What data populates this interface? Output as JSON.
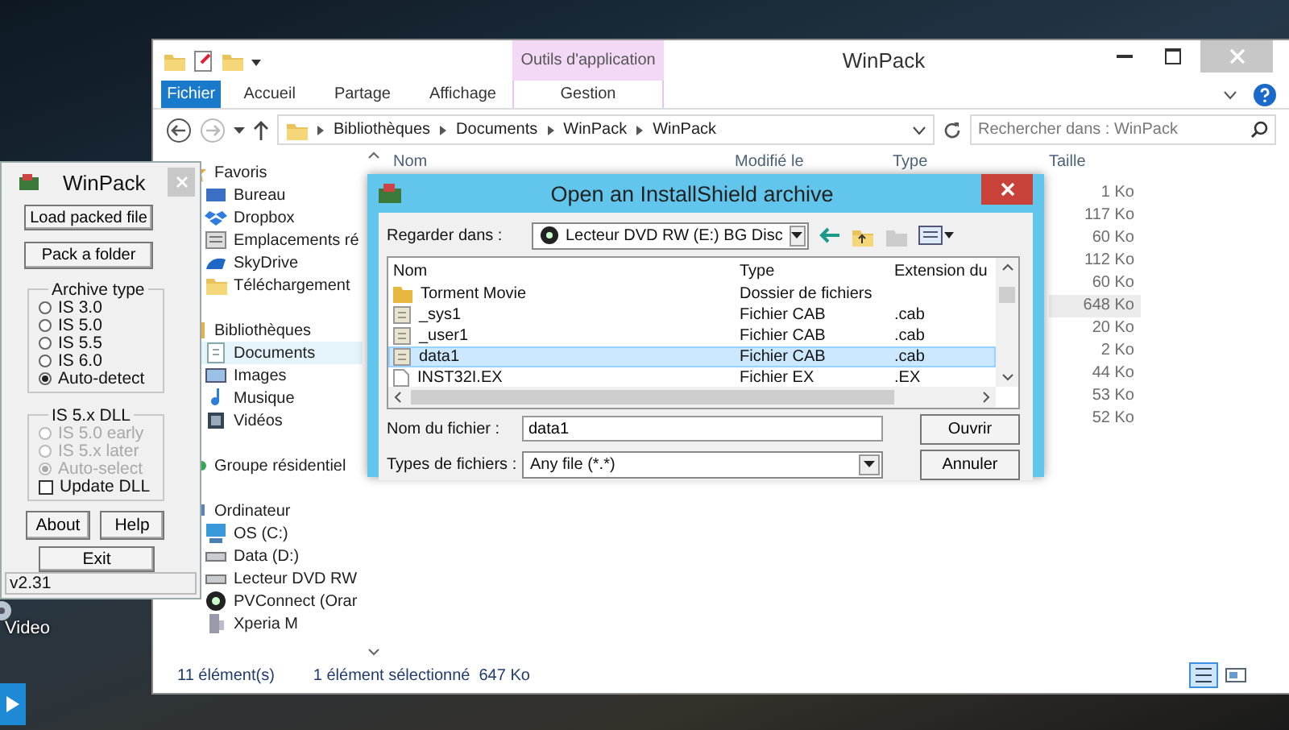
{
  "desktop": {
    "icon_label": "Video"
  },
  "explorer": {
    "title": "WinPack",
    "context_group": "Outils d'application",
    "ribbon_tabs": [
      {
        "label": "Fichier",
        "kind": "file",
        "selected": false
      },
      {
        "label": "Accueil",
        "kind": "tab",
        "selected": false
      },
      {
        "label": "Partage",
        "kind": "tab",
        "selected": false
      },
      {
        "label": "Affichage",
        "kind": "tab",
        "selected": false
      },
      {
        "label": "Gestion",
        "kind": "context",
        "selected": false
      }
    ],
    "breadcrumb": [
      "Bibliothèques",
      "Documents",
      "WinPack",
      "WinPack"
    ],
    "search": {
      "placeholder": "Rechercher dans : WinPack"
    },
    "nav": [
      {
        "label": "Favoris",
        "selected": false,
        "children": [
          {
            "label": "Bureau",
            "selected": false
          },
          {
            "label": "Dropbox",
            "selected": false
          },
          {
            "label": "Emplacements ré",
            "selected": false
          },
          {
            "label": "SkyDrive",
            "selected": false
          },
          {
            "label": "Téléchargement",
            "selected": false
          }
        ]
      },
      {
        "label": "Bibliothèques",
        "selected": false,
        "children": [
          {
            "label": "Documents",
            "selected": true
          },
          {
            "label": "Images",
            "selected": false
          },
          {
            "label": "Musique",
            "selected": false
          },
          {
            "label": "Vidéos",
            "selected": false
          }
        ]
      },
      {
        "label": "Groupe résidentiel",
        "selected": false
      },
      {
        "label": "Ordinateur",
        "selected": false,
        "children": [
          {
            "label": "OS (C:)",
            "selected": false
          },
          {
            "label": "Data (D:)",
            "selected": false
          },
          {
            "label": "Lecteur DVD RW",
            "selected": false
          },
          {
            "label": "PVConnect (Orar",
            "selected": false
          },
          {
            "label": "Xperia M",
            "selected": false
          }
        ]
      }
    ],
    "columns": [
      "Nom",
      "Modifié le",
      "Type",
      "Taille"
    ],
    "rows": [
      {
        "size": "1 Ko",
        "selected": false
      },
      {
        "size": "117 Ko",
        "selected": false
      },
      {
        "size": "60 Ko",
        "selected": false
      },
      {
        "size": "112 Ko",
        "selected": false
      },
      {
        "size": "60 Ko",
        "selected": false
      },
      {
        "size": "648 Ko",
        "selected": true
      },
      {
        "size": "20 Ko",
        "selected": false
      },
      {
        "size": "2 Ko",
        "selected": false
      },
      {
        "size": "44 Ko",
        "selected": false
      },
      {
        "size": "53 Ko",
        "selected": false
      },
      {
        "size": "52 Ko",
        "selected": false
      }
    ],
    "status": {
      "count": "11 élément(s)",
      "selection": "1 élément sélectionné  647 Ko"
    }
  },
  "winpack": {
    "title": "WinPack",
    "buttons": [
      "Load packed file",
      "Pack a folder"
    ],
    "archive_type": {
      "label": "Archive type",
      "options": [
        {
          "label": "IS 3.0",
          "selected": false
        },
        {
          "label": "IS 5.0",
          "selected": false
        },
        {
          "label": "IS 5.5",
          "selected": false
        },
        {
          "label": "IS 6.0",
          "selected": false
        },
        {
          "label": "Auto-detect",
          "selected": true
        }
      ]
    },
    "dll": {
      "label": "IS 5.x DLL",
      "options": [
        {
          "label": "IS 5.0 early",
          "selected": false,
          "disabled": true
        },
        {
          "label": "IS 5.x later",
          "selected": false,
          "disabled": true
        },
        {
          "label": "Auto-select",
          "selected": true,
          "disabled": true
        }
      ],
      "update": {
        "label": "Update DLL",
        "checked": false
      }
    },
    "about": "About",
    "help": "Help",
    "exit": "Exit",
    "version": "v2.31"
  },
  "dialog": {
    "title": "Open an InstallShield archive",
    "look_in_label": "Regarder dans :",
    "look_in_value": "Lecteur DVD RW (E:) BG Disc",
    "columns": [
      "Nom",
      "Type",
      "Extension du"
    ],
    "files": [
      {
        "name": "Torment Movie",
        "type": "Dossier de fichiers",
        "kind": "folder",
        "selected": false
      },
      {
        "name": "_sys1",
        "type": "Fichier CAB",
        "ext": ".cab",
        "kind": "cab",
        "selected": false
      },
      {
        "name": "_user1",
        "type": "Fichier CAB",
        "ext": ".cab",
        "kind": "cab",
        "selected": false
      },
      {
        "name": "data1",
        "type": "Fichier CAB",
        "ext": ".cab",
        "kind": "cab",
        "selected": true
      },
      {
        "name": "INST32I.EX",
        "type": "Fichier EX",
        "ext": ".EX",
        "kind": "file",
        "selected": false
      }
    ],
    "filename_label": "Nom du fichier :",
    "filename_value": "data1",
    "filetype_label": "Types de fichiers :",
    "filetype_value": "Any file (*.*)",
    "open": "Ouvrir",
    "cancel": "Annuler"
  }
}
